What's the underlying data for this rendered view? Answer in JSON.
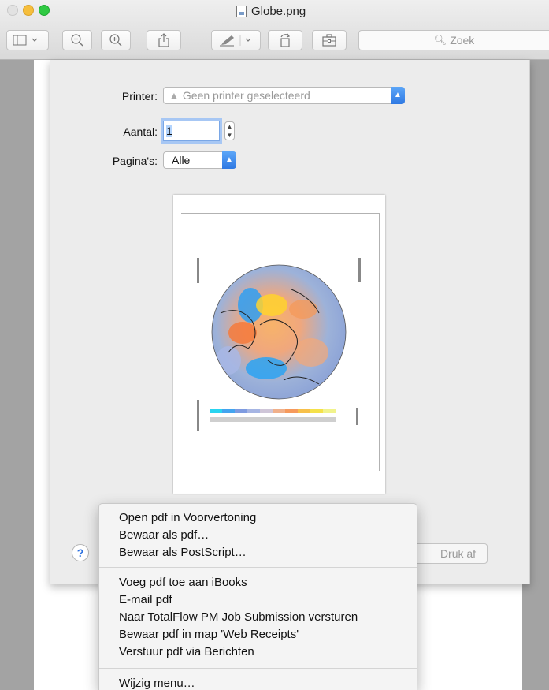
{
  "window": {
    "title": "Globe.png",
    "search_placeholder": "Zoek"
  },
  "toolbar": {
    "icons": [
      "sidebar-icon",
      "zoom-out-icon",
      "zoom-in-icon",
      "share-icon",
      "markup-pen-icon",
      "rotate-icon",
      "toolbox-icon"
    ]
  },
  "print_dialog": {
    "printer_label": "Printer:",
    "printer_value": "Geen printer geselecteerd",
    "copies_label": "Aantal:",
    "copies_value": "1",
    "pages_label": "Pagina's:",
    "pages_value": "Alle",
    "print_button": "Druk af",
    "help_button": "?"
  },
  "pdf_menu": {
    "group1": [
      "Open pdf in Voorvertoning",
      "Bewaar als pdf…",
      "Bewaar als PostScript…"
    ],
    "group2": [
      "Voeg pdf toe aan iBooks",
      "E-mail pdf",
      "Naar TotalFlow PM Job Submission versturen",
      "Bewaar pdf in map 'Web Receipts'",
      "Verstuur pdf via Berichten"
    ],
    "group3": [
      "Wijzig menu…"
    ]
  },
  "colors": {
    "accent_blue": "#2f79e3",
    "close_light": "#e2e2e2",
    "minimize_light": "#f6be3b",
    "zoom_light": "#2fc942"
  }
}
